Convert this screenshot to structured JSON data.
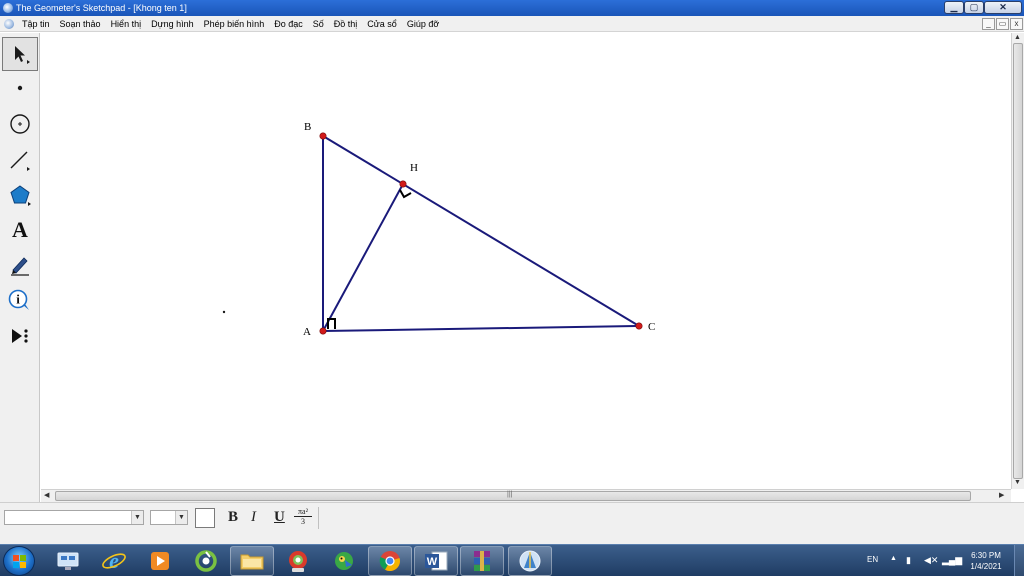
{
  "window": {
    "title": "The Geometer's Sketchpad - [Khong ten 1]",
    "controls": {
      "minimize": "▁",
      "maximize": "▢",
      "close": "✕"
    }
  },
  "menu": {
    "items": [
      "Tập tin",
      "Soạn thảo",
      "Hiển thị",
      "Dựng hình",
      "Phép biến hình",
      "Đo đạc",
      "Số",
      "Đồ thị",
      "Cửa sổ",
      "Giúp đỡ"
    ],
    "doc_controls": {
      "minimize": "_",
      "restore": "▭",
      "close": "x"
    }
  },
  "toolbox": {
    "tools": [
      {
        "name": "selection-arrow-tool",
        "icon": "arrow-icon",
        "active": true
      },
      {
        "name": "point-tool",
        "icon": "point-icon"
      },
      {
        "name": "compass-tool",
        "icon": "circle-icon"
      },
      {
        "name": "straightedge-tool",
        "icon": "line-icon"
      },
      {
        "name": "polygon-tool",
        "icon": "pentagon-icon"
      },
      {
        "name": "text-tool",
        "icon": "text-a-icon",
        "glyph": "A"
      },
      {
        "name": "marker-tool",
        "icon": "pen-icon"
      },
      {
        "name": "information-tool",
        "icon": "info-icon",
        "glyph": "i"
      },
      {
        "name": "custom-tool",
        "icon": "play-more-icon"
      }
    ]
  },
  "sketch": {
    "points": {
      "A": {
        "label": "A"
      },
      "B": {
        "label": "B"
      },
      "C": {
        "label": "C"
      },
      "H": {
        "label": "H"
      }
    },
    "colors": {
      "segment": "#1a1a7a",
      "point": "#d11a1a",
      "right_angle_mark": "#000000"
    }
  },
  "textbar": {
    "font_value": "",
    "size_value": "",
    "bold": "B",
    "italic": "I",
    "underline": "U",
    "math_format_top": "πa²",
    "math_format_bottom": "3"
  },
  "taskbar": {
    "apps": [
      {
        "name": "remote-desktop",
        "icon": "monitor-icon",
        "open": false
      },
      {
        "name": "internet-explorer",
        "icon": "ie-icon",
        "open": false
      },
      {
        "name": "media-player",
        "icon": "media-icon",
        "open": false
      },
      {
        "name": "green-app",
        "icon": "green-swirl-icon",
        "open": false
      },
      {
        "name": "file-explorer",
        "icon": "folder-icon",
        "open": true
      },
      {
        "name": "coccoc-browser",
        "icon": "browser-icon",
        "open": false
      },
      {
        "name": "parrot-app",
        "icon": "parrot-icon",
        "open": false
      },
      {
        "name": "chrome",
        "icon": "chrome-icon",
        "open": true
      },
      {
        "name": "word",
        "icon": "word-icon",
        "open": true
      },
      {
        "name": "winrar",
        "icon": "winrar-icon",
        "open": true
      },
      {
        "name": "geometers-sketchpad",
        "icon": "sketchpad-icon",
        "open": true
      }
    ],
    "tray": {
      "language": "EN",
      "time": "6:30 PM",
      "date": "1/4/2021"
    }
  }
}
